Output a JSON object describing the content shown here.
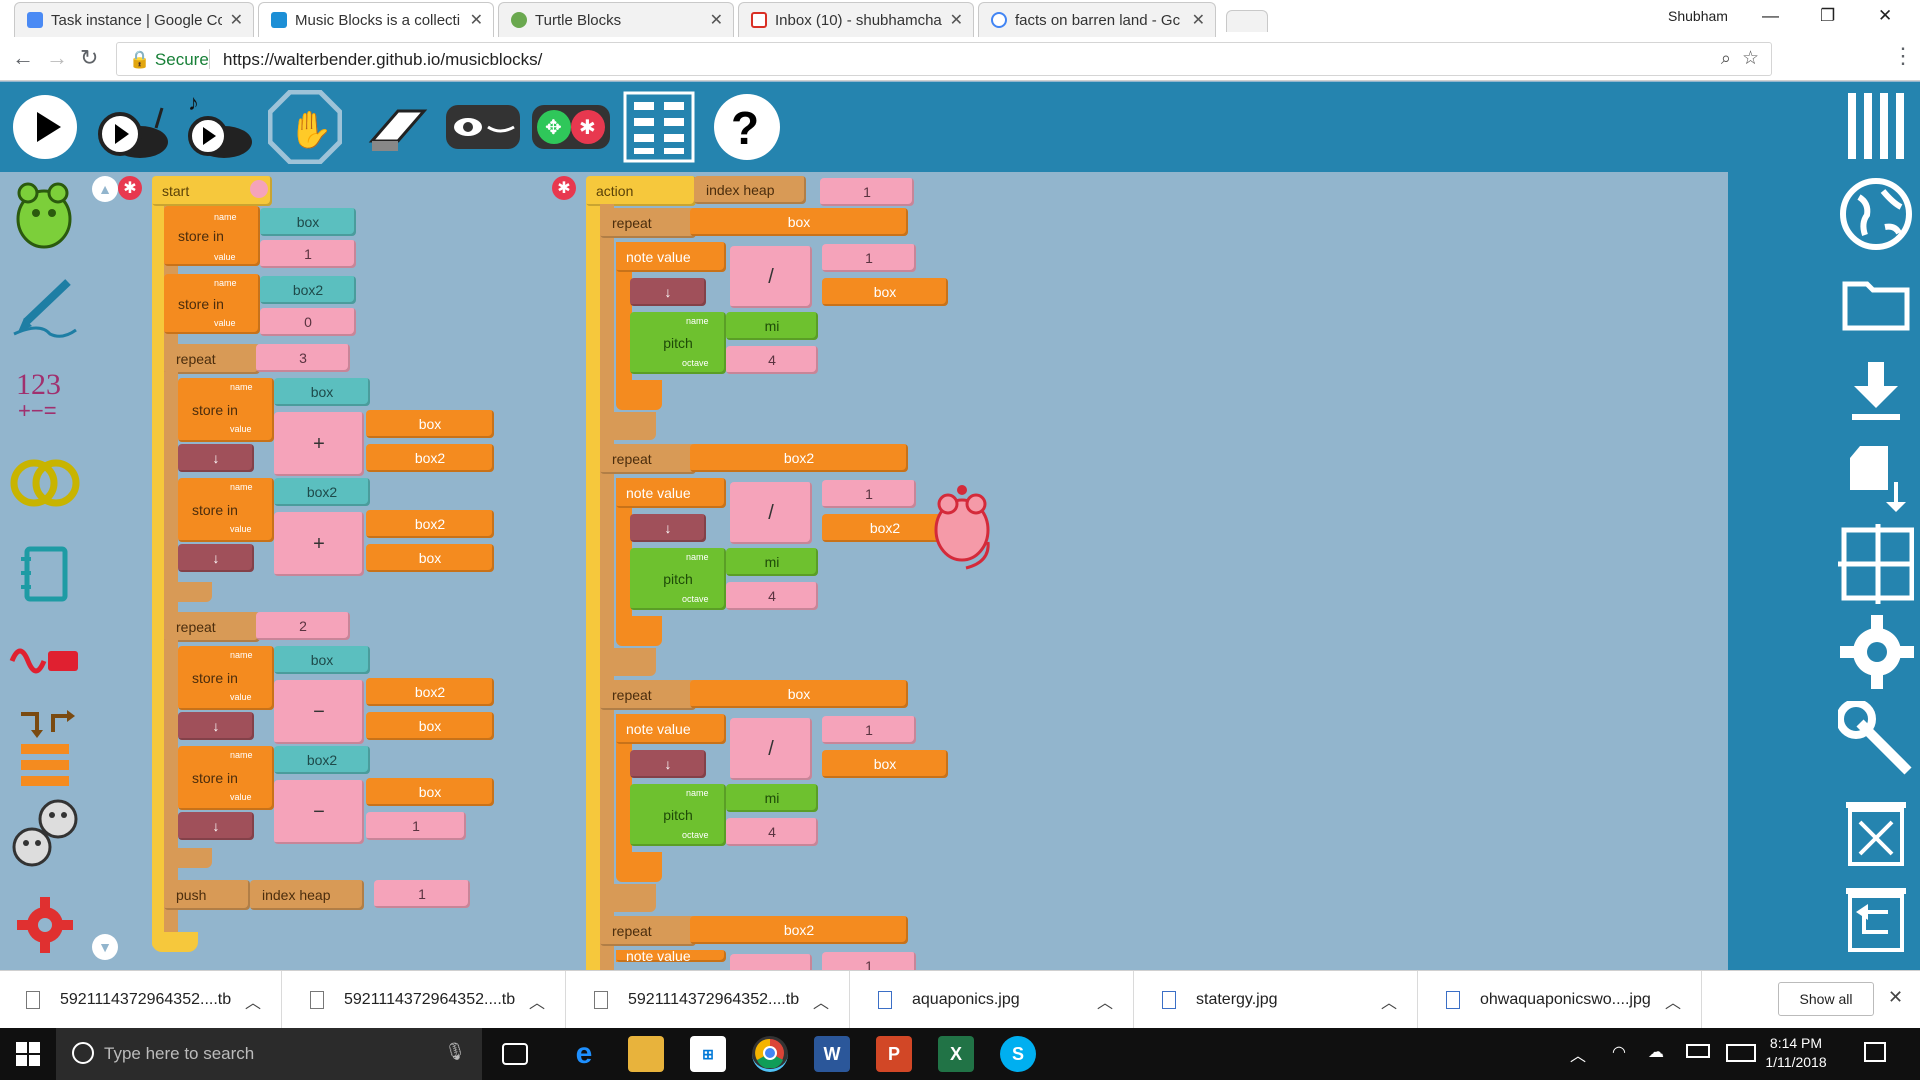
{
  "browser": {
    "tabs": [
      {
        "title": "Task instance | Google Cc",
        "favicon": "gear-icon",
        "color": "#4a8af4"
      },
      {
        "title": "Music Blocks is a collecti",
        "favicon": "music-blocks-icon",
        "color": "#1c8fd6"
      },
      {
        "title": "Turtle Blocks",
        "favicon": "turtle-icon",
        "color": "#6aa84f"
      },
      {
        "title": "Inbox (10) - shubhamcha",
        "favicon": "gmail-icon",
        "color": "#d93025"
      },
      {
        "title": "facts on barren land - Gc",
        "favicon": "google-icon",
        "color": "#4285f4"
      }
    ],
    "profile": "Shubham",
    "secure_label": "Secure",
    "url": "https://walterbender.github.io/musicblocks/"
  },
  "blocks": {
    "start": "start",
    "action": "action",
    "store_in": "store in",
    "name_tag": "name",
    "value_tag": "value",
    "octave_tag": "octave",
    "repeat": "repeat",
    "push": "push",
    "index_heap": "index heap",
    "note_value": "note value",
    "pitch": "pitch",
    "box": "box",
    "box2": "box2",
    "mi": "mi",
    "v0": "0",
    "v1": "1",
    "v2": "2",
    "v3": "3",
    "v4": "4",
    "plus": "+",
    "minus": "−",
    "div": "/",
    "down": "↓"
  },
  "palette_left": [
    "rhythm-mouse-icon",
    "pen-icon",
    "number-icon",
    "boolean-rings-icon",
    "notebook-icon",
    "sensor-icon",
    "flow-icon",
    "mice-icon",
    "extras-gear-icon"
  ],
  "downloads": {
    "items": [
      "5921114372964352....tb",
      "5921114372964352....tb",
      "5921114372964352....tb",
      "aquaponics.jpg",
      "statergy.jpg",
      "ohwaquaponicswo....jpg"
    ],
    "show_all": "Show all"
  },
  "taskbar": {
    "search_placeholder": "Type here to search",
    "time": "8:14 PM",
    "date": "1/11/2018"
  },
  "colors": {
    "toolbar": "#2584af",
    "canvas": "#92b5cd",
    "orange": "#f48b1f",
    "pink": "#f5a3ba",
    "teal": "#5bbfbf",
    "green": "#6ec12f"
  }
}
